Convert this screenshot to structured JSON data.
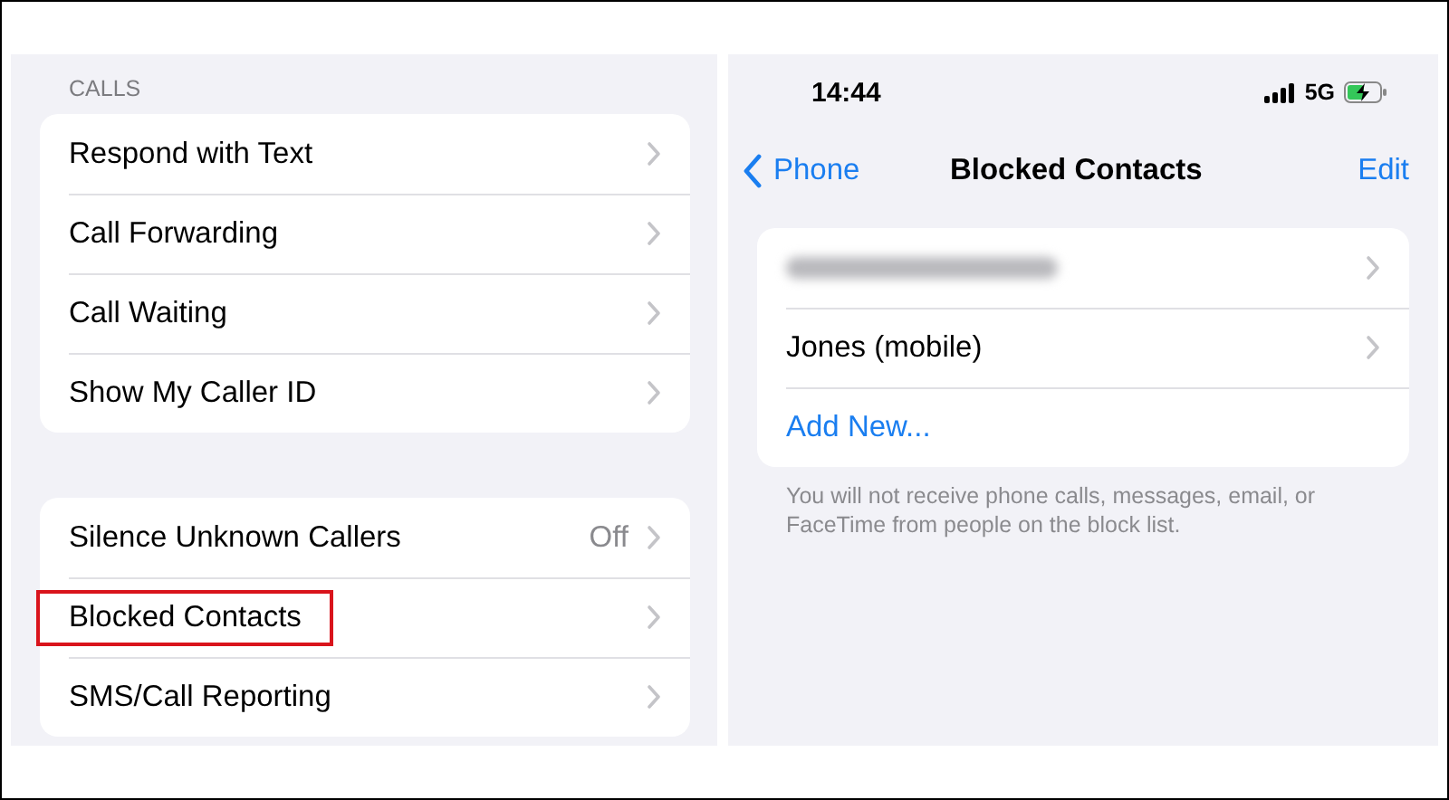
{
  "settings": {
    "section_header": "CALLS",
    "groups": [
      {
        "rows": [
          {
            "label": "Respond with Text",
            "highlighted": false
          },
          {
            "label": "Call Forwarding",
            "highlighted": false
          },
          {
            "label": "Call Waiting",
            "highlighted": false
          },
          {
            "label": "Show My Caller ID",
            "highlighted": false
          }
        ]
      },
      {
        "rows": [
          {
            "label": "Silence Unknown Callers",
            "value": "Off",
            "highlighted": false
          },
          {
            "label": "Blocked Contacts",
            "highlighted": true
          },
          {
            "label": "SMS/Call Reporting",
            "highlighted": false
          }
        ]
      }
    ]
  },
  "phone": {
    "status_bar": {
      "time": "14:44",
      "network": "5G"
    },
    "nav": {
      "back": "Phone",
      "title": "Blocked Contacts",
      "action": "Edit"
    },
    "list": [
      {
        "kind": "obscured"
      },
      {
        "kind": "contact",
        "label": "Jones (mobile)"
      },
      {
        "kind": "action",
        "label": "Add New..."
      }
    ],
    "footer": "You will not receive phone calls, messages, email, or FaceTime from people on the block list."
  }
}
